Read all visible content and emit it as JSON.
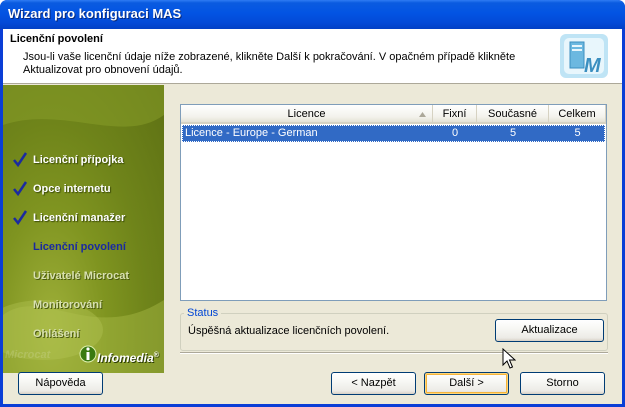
{
  "window": {
    "title": "Wizard pro konfiguraci MAS"
  },
  "header": {
    "title": "Licenční povolení",
    "description": "Jsou-li vaše licenční údaje níže zobrazené, klikněte Další k pokračování. V opačném případě klikněte Aktualizovat pro obnovení údajů.",
    "logo_icon": "mas-server-logo-icon"
  },
  "steps": [
    {
      "label": "Licenční přípojka",
      "state": "done"
    },
    {
      "label": "Opce internetu",
      "state": "done"
    },
    {
      "label": "Licenční manažer",
      "state": "done"
    },
    {
      "label": "Licenční povolení",
      "state": "current"
    },
    {
      "label": "Uživatelé Microcat",
      "state": "todo"
    },
    {
      "label": "Monitorování",
      "state": "todo"
    },
    {
      "label": "Ohlášení",
      "state": "todo"
    }
  ],
  "brand": {
    "name": "Infomedia",
    "mark": "®",
    "watermark": "Microcat"
  },
  "licence_table": {
    "columns": [
      "Licence",
      "Fixní",
      "Současné",
      "Celkem"
    ],
    "rows": [
      {
        "licence": "Licence - Europe - German",
        "fixni": "0",
        "soucasne": "5",
        "celkem": "5",
        "selected": true
      }
    ]
  },
  "status": {
    "legend": "Status",
    "text": "Úspěšná aktualizace licenčních povolení."
  },
  "buttons": {
    "update": "Aktualizace",
    "help": "Nápověda",
    "back": "< Nazpět",
    "next": "Další >",
    "cancel": "Storno"
  },
  "colors": {
    "titlebar": "#0354e3",
    "selection": "#316ac5",
    "current_step": "#1a2aa0",
    "sidepanel": "#7f9420",
    "status_legend": "#0046d5"
  }
}
